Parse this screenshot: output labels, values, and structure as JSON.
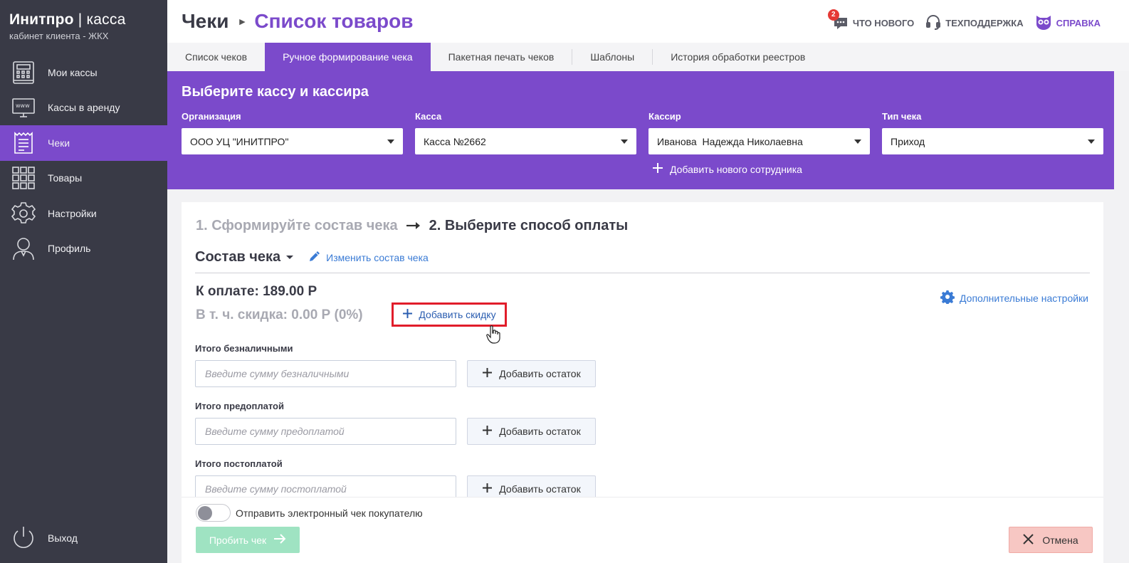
{
  "brand": {
    "title_bold": "Инитпро",
    "title_sep": " | ",
    "title_thin": "касса",
    "subtitle": "кабинет клиента - ЖКХ"
  },
  "sidebar": {
    "items": [
      {
        "label": "Мои кассы",
        "icon": "cash-register-icon"
      },
      {
        "label": "Кассы в аренду",
        "icon": "www-monitor-icon"
      },
      {
        "label": "Чеки",
        "icon": "receipt-icon",
        "active": true
      },
      {
        "label": "Товары",
        "icon": "grid-icon"
      },
      {
        "label": "Настройки",
        "icon": "gear-icon"
      },
      {
        "label": "Профиль",
        "icon": "user-icon"
      }
    ],
    "exit_label": "Выход"
  },
  "header": {
    "crumb1": "Чеки",
    "crumb2": "Список товаров",
    "whats_new": "ЧТО НОВОГО",
    "whats_new_badge": "2",
    "support": "ТЕХПОДДЕРЖКА",
    "help": "СПРАВКА"
  },
  "tabs": [
    {
      "label": "Список чеков"
    },
    {
      "label": "Ручное формирование чека",
      "active": true
    },
    {
      "label": "Пакетная печать чеков"
    },
    {
      "label": "Шаблоны"
    },
    {
      "label": "История обработки реестров"
    }
  ],
  "panel": {
    "title": "Выберите кассу и кассира",
    "org_label": "Организация",
    "org_value": "ООО УЦ \"ИНИТПРО\"",
    "kassa_label": "Касса",
    "kassa_value": "Касса №2662",
    "cashier_label": "Кассир",
    "cashier_value": "Иванова  Надежда Николаевна",
    "type_label": "Тип чека",
    "type_value": "Приход",
    "add_employee": "Добавить нового сотрудника"
  },
  "card": {
    "step1": "1. Сформируйте состав чека",
    "step2": "2. Выберите способ оплаты",
    "compose_title": "Состав чека",
    "edit_link": "Изменить состав чека",
    "to_pay": "К оплате: 189.00 Р",
    "discount": "В т. ч. скидка: 0.00 Р (0%)",
    "add_discount": "Добавить скидку",
    "more_settings": "Дополнительные настройки",
    "cashless_label": "Итого безналичными",
    "cashless_placeholder": "Введите сумму безналичными",
    "prepaid_label": "Итого предоплатой",
    "prepaid_placeholder": "Введите сумму предоплатой",
    "postpaid_label": "Итого постоплатой",
    "postpaid_placeholder": "Введите сумму постоплатой",
    "add_remainder": "Добавить остаток"
  },
  "bottom": {
    "send_receipt": "Отправить электронный чек покупателю",
    "send_receipt_on": false,
    "pay_button": "Пробить чек",
    "cancel_button": "Отмена"
  },
  "colors": {
    "accent": "#7b4acb",
    "sidebar": "#393a46",
    "link": "#3a7bd5",
    "highlight": "#e11d2a"
  }
}
